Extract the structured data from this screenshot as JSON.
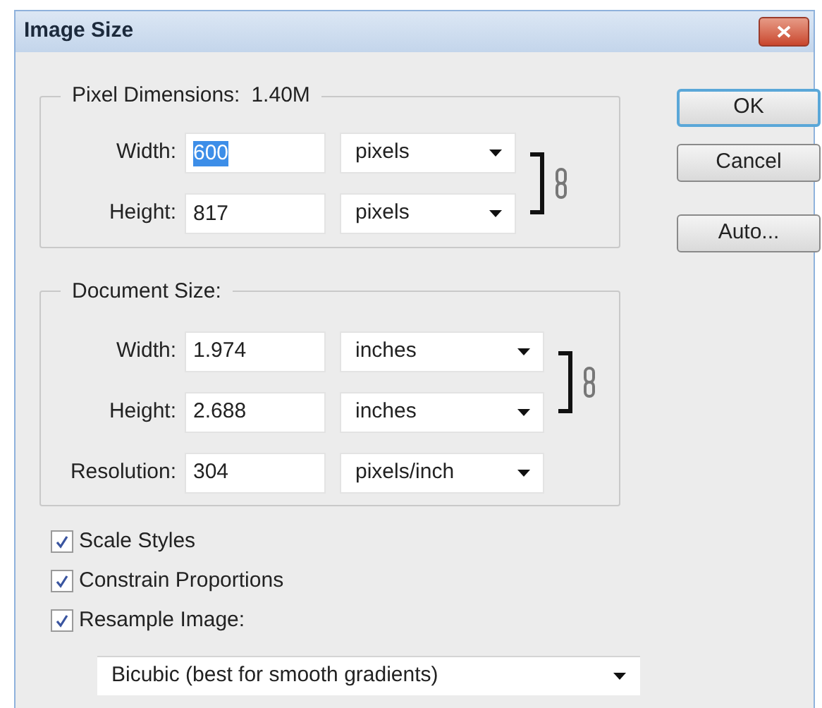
{
  "window": {
    "title": "Image Size"
  },
  "pixel_dimensions": {
    "label": "Pixel Dimensions:",
    "value": "1.40M",
    "linked": true,
    "rows": [
      {
        "label": "Width:",
        "value": "600",
        "text_selected": true,
        "unit": "pixels",
        "linked": true
      },
      {
        "label": "Height:",
        "value": "817",
        "text_selected": false,
        "unit": "pixels",
        "linked": true
      }
    ]
  },
  "document_size": {
    "label": "Document Size:",
    "linked": true,
    "rows": [
      {
        "label": "Width:",
        "value": "1.974",
        "text_selected": false,
        "unit": "inches",
        "linked": true
      },
      {
        "label": "Height:",
        "value": "2.688",
        "text_selected": false,
        "unit": "inches",
        "linked": true
      },
      {
        "label": "Resolution:",
        "value": "304",
        "text_selected": false,
        "unit": "pixels/inch",
        "linked": false
      }
    ]
  },
  "checkboxes": [
    {
      "label": "Scale Styles",
      "checked": true
    },
    {
      "label": "Constrain Proportions",
      "checked": true
    },
    {
      "label": "Resample Image:",
      "checked": true
    }
  ],
  "resample_method": "Bicubic (best for smooth gradients)",
  "buttons": [
    {
      "label": "OK",
      "default": true,
      "kind": "dialog"
    },
    {
      "label": "Cancel",
      "default": false,
      "kind": "dialog"
    },
    {
      "label": "Auto...",
      "default": false,
      "kind": "extra"
    }
  ]
}
